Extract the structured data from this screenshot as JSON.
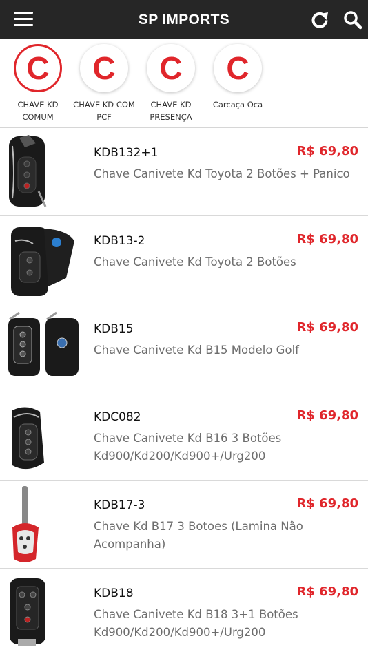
{
  "header": {
    "title": "SP IMPORTS",
    "menu_icon": "hamburger-menu-icon",
    "refresh_icon": "refresh-icon",
    "search_icon": "search-icon",
    "background": "#262626"
  },
  "categories": [
    {
      "letter": "C",
      "label": "CHAVE KD COMUM",
      "active": true
    },
    {
      "letter": "C",
      "label": "CHAVE KD COM PCF",
      "active": false
    },
    {
      "letter": "C",
      "label": "CHAVE KD PRESENÇA",
      "active": false
    },
    {
      "letter": "C",
      "label": "Carcaça Oca",
      "active": false
    }
  ],
  "products": [
    {
      "code": "KDB132+1",
      "description": "Chave Canivete Kd Toyota 2 Botões + Panico",
      "price": "R$ 69,80"
    },
    {
      "code": "KDB13-2",
      "description": "Chave Canivete Kd Toyota 2 Botões",
      "price": "R$ 69,80"
    },
    {
      "code": "KDB15",
      "description": "Chave Canivete Kd B15 Modelo Golf",
      "price": "R$ 69,80"
    },
    {
      "code": "KDC082",
      "description": "Chave Canivete Kd B16 3 Botões Kd900/Kd200/Kd900+/Urg200",
      "price": "R$ 69,80"
    },
    {
      "code": "KDB17-3",
      "description": "Chave Kd B17 3 Botoes (Lamina Não Acompanha)",
      "price": "R$ 69,80"
    },
    {
      "code": "KDB18",
      "description": "Chave Canivete Kd B18 3+1 Botões Kd900/Kd200/Kd900+/Urg200",
      "price": "R$ 69,80"
    }
  ],
  "colors": {
    "accent": "#e0262b",
    "price": "#e0262b",
    "divider": "#d9d9d9"
  }
}
